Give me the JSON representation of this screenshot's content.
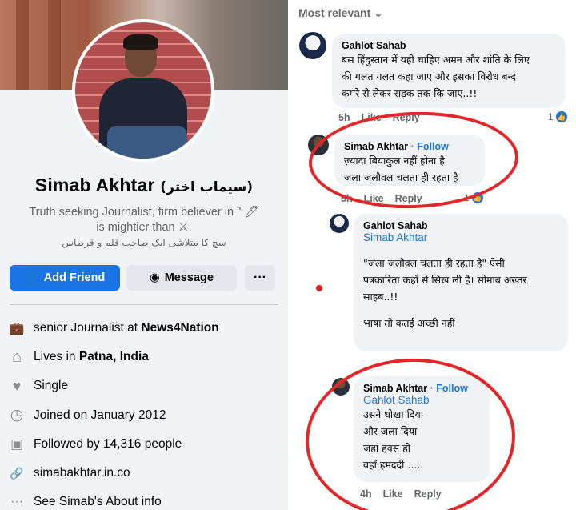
{
  "profile": {
    "name": "Simab Akhtar",
    "name_urdu": "(سیماب اختر)",
    "bio_line1": "Truth seeking Journalist, firm believer in \" 🖊",
    "bio_line2": "is mightier than ⚔.",
    "bio_urdu": "سچ کا متلاشی ایک صاحب قلم و قرطاس"
  },
  "buttons": {
    "add_friend": "Add Friend",
    "message": "Message",
    "more": "···"
  },
  "intro": [
    {
      "icon": "briefcase-icon",
      "glyph": "💼",
      "prefix": "senior Journalist at ",
      "bold": "News4Nation"
    },
    {
      "icon": "home-icon",
      "glyph": "⌂",
      "prefix": "Lives in ",
      "bold": "Patna, India"
    },
    {
      "icon": "heart-icon",
      "glyph": "♥",
      "prefix": "Single",
      "bold": ""
    },
    {
      "icon": "clock-icon",
      "glyph": "◷",
      "prefix": "Joined on January 2012",
      "bold": ""
    },
    {
      "icon": "followers-icon",
      "glyph": "▣",
      "prefix": "Followed by 14,316 people",
      "bold": ""
    },
    {
      "icon": "link-icon",
      "glyph": "🔗",
      "prefix": "simabakhtar.in.co",
      "bold": ""
    },
    {
      "icon": "more-dots-icon",
      "glyph": "···",
      "prefix": "See Simab's About info",
      "bold": ""
    }
  ],
  "comments": {
    "sort_label": "Most relevant ⌄",
    "c1": {
      "name": "Gahlot Sahab",
      "line1": "बस हिंदुस्तान में यही चाहिए अमन और शांति के लिए",
      "line2": "की गलत गलत कहा जाए और इसका विरोध बन्द",
      "line3": "कमरे से लेकर सड़क तक कि जाए..!!",
      "time": "5h",
      "like": "Like",
      "reply": "Reply",
      "reactions": "1"
    },
    "c2": {
      "name": "Simab Akhtar",
      "follow": "· Follow",
      "line1": "ज़्यादा बियाकुल नहीं होना है",
      "line2": "जला जलौवल चलता ही रहता है",
      "time": "5h",
      "like": "Like",
      "reply": "Reply",
      "reactions": "1"
    },
    "c3": {
      "name": "Gahlot Sahab",
      "tag": "Simab Akhtar",
      "line1": "\"जला जलौवल चलता ही रहता है\"  ऐसी",
      "line2": "पत्रकारिता कहाँ से सिख ली है। सीमाब अख्तर",
      "line3": "साहब..!!",
      "line4": "भाषा तो कतई अच्छी नहीं"
    },
    "c4": {
      "name": "Simab Akhtar",
      "follow": "· Follow",
      "tag": "Gahlot Sahab",
      "line1": "उसने धोखा दिया",
      "line2": "और जला दिया",
      "line3": "जहां हवस हो",
      "line4": "वहाँ हमदर्दी .....",
      "time": "4h",
      "like": "Like",
      "reply": "Reply"
    }
  },
  "colors": {
    "accent": "#1b74e4",
    "annotation_red": "#e3262a",
    "secondary_text": "#65676b"
  }
}
